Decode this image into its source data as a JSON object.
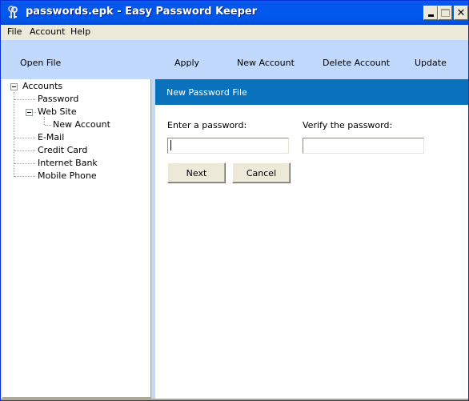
{
  "window": {
    "title": "passwords.epk - Easy Password Keeper",
    "app_icon": "keys-icon",
    "controls": {
      "minimize": "minimize-icon",
      "maximize": "maximize-icon",
      "close": "close-icon"
    }
  },
  "menubar": {
    "items": [
      "File",
      "Account",
      "Help"
    ]
  },
  "toolbar": {
    "open_file": "Open File",
    "apply": "Apply",
    "new_account": "New Account",
    "delete_account": "Delete Account",
    "update": "Update"
  },
  "tree": {
    "root": "Accounts",
    "items": [
      {
        "label": "Password",
        "level": 1
      },
      {
        "label": "Web Site",
        "level": 1,
        "expanded": true
      },
      {
        "label": "New Account",
        "level": 2
      },
      {
        "label": "E-Mail",
        "level": 1
      },
      {
        "label": "Credit Card",
        "level": 1
      },
      {
        "label": "Internet Bank",
        "level": 1
      },
      {
        "label": "Mobile Phone",
        "level": 1
      }
    ]
  },
  "main": {
    "header_title": "New Password File",
    "enter_label": "Enter a password:",
    "enter_value": "",
    "verify_label": "Verify the password:",
    "verify_value": "",
    "next_label": "Next",
    "cancel_label": "Cancel"
  },
  "colors": {
    "titlebar": "#0058ee",
    "toolbar": "#c1d9fc",
    "header_bar": "#0a72bd",
    "chrome": "#ece9d8"
  }
}
